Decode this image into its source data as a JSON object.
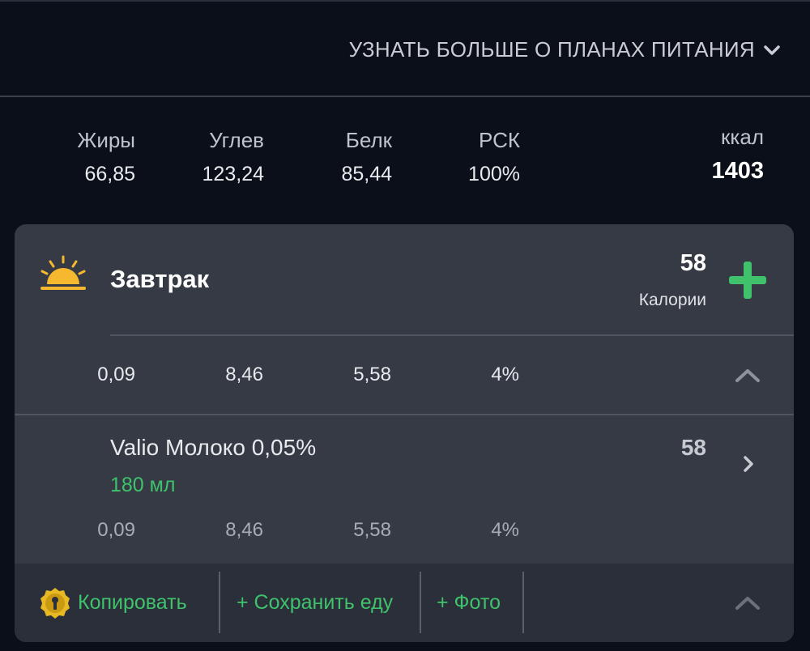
{
  "header": {
    "plans_link": "УЗНАТЬ БОЛЬШЕ О ПЛАНАХ ПИТАНИЯ"
  },
  "summary": {
    "labels": [
      "Жиры",
      "Углев",
      "Белк",
      "РСК",
      "ккал"
    ],
    "values": [
      "66,85",
      "123,24",
      "85,44",
      "100%",
      "1403"
    ]
  },
  "meal": {
    "title": "Завтрак",
    "icon": "sunrise-icon",
    "calories": "58",
    "calories_label": "Калории",
    "macros": [
      "0,09",
      "8,46",
      "5,58",
      "4%"
    ],
    "items": [
      {
        "name": "Valio Молоко 0,05%",
        "quantity": "180 мл",
        "calories": "58",
        "macros": [
          "0,09",
          "8,46",
          "5,58",
          "4%"
        ]
      }
    ]
  },
  "footer": {
    "copy_label": "Копировать",
    "save_food_label": "+ Сохранить еду",
    "photo_label": "+ Фото"
  },
  "colors": {
    "background": "#0b0f1a",
    "card": "#353a45",
    "accent_green": "#3fc26b",
    "sun_yellow": "#f5b82e"
  }
}
